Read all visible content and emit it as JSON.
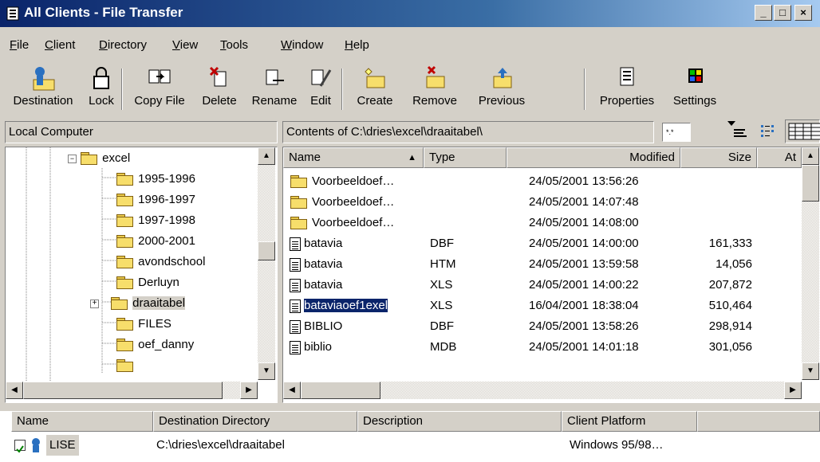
{
  "window": {
    "title": "All Clients - File Transfer",
    "buttons": [
      "_",
      "□",
      "×"
    ]
  },
  "menu": [
    {
      "label": "File",
      "u": "F",
      "rest": "ile"
    },
    {
      "label": "Client",
      "u": "C",
      "rest": "lient"
    },
    {
      "label": "Directory",
      "u": "D",
      "rest": "irectory"
    },
    {
      "label": "View",
      "u": "V",
      "rest": "iew"
    },
    {
      "label": "Tools",
      "u": "T",
      "rest": "ools"
    },
    {
      "label": "Window",
      "u": "W",
      "rest": "indow"
    },
    {
      "label": "Help",
      "u": "H",
      "rest": "elp"
    }
  ],
  "toolbar": {
    "destination": "Destination",
    "lock": "Lock",
    "copy_file": "Copy File",
    "delete": "Delete",
    "rename": "Rename",
    "edit": "Edit",
    "create": "Create",
    "remove": "Remove",
    "previous": "Previous",
    "properties": "Properties",
    "settings": "Settings"
  },
  "local_header": "Local Computer",
  "contents_header": "Contents of C:\\dries\\excel\\draaitabel\\",
  "filter_value": "*.*",
  "tree": [
    {
      "label": "excel",
      "expander": "−"
    },
    {
      "label": "1995-1996"
    },
    {
      "label": "1996-1997"
    },
    {
      "label": "1997-1998"
    },
    {
      "label": "2000-2001"
    },
    {
      "label": "avondschool"
    },
    {
      "label": "Derluyn"
    },
    {
      "label": "draaitabel",
      "expander": "+"
    },
    {
      "label": "FILES"
    },
    {
      "label": "oef_danny"
    }
  ],
  "columns": {
    "name": "Name",
    "type": "Type",
    "modified": "Modified",
    "size": "Size",
    "attr": "At"
  },
  "sort_indicator": "▲",
  "files": [
    {
      "name": "Voorbeeldoef…",
      "type": "",
      "modified": "24/05/2001 13:56:26",
      "size": "",
      "icon": "folder"
    },
    {
      "name": "Voorbeeldoef…",
      "type": "",
      "modified": "24/05/2001 14:07:48",
      "size": "",
      "icon": "folder"
    },
    {
      "name": "Voorbeeldoef…",
      "type": "",
      "modified": "24/05/2001 14:08:00",
      "size": "",
      "icon": "folder"
    },
    {
      "name": "batavia",
      "type": "DBF",
      "modified": "24/05/2001 14:00:00",
      "size": "161,333",
      "icon": "doc"
    },
    {
      "name": "batavia",
      "type": "HTM",
      "modified": "24/05/2001 13:59:58",
      "size": "14,056",
      "icon": "doc"
    },
    {
      "name": "batavia",
      "type": "XLS",
      "modified": "24/05/2001 14:00:22",
      "size": "207,872",
      "icon": "doc"
    },
    {
      "name": "bataviaoef1exel",
      "type": "XLS",
      "modified": "16/04/2001 18:38:04",
      "size": "510,464",
      "icon": "doc"
    },
    {
      "name": "BIBLIO",
      "type": "DBF",
      "modified": "24/05/2001 13:58:26",
      "size": "298,914",
      "icon": "doc"
    },
    {
      "name": "biblio",
      "type": "MDB",
      "modified": "24/05/2001 14:01:18",
      "size": "301,056",
      "icon": "doc"
    }
  ],
  "bottom_columns": {
    "name": "Name",
    "dest": "Destination Directory",
    "desc": "Description",
    "platform": "Client Platform"
  },
  "client": {
    "name": "LISE",
    "dest": "C:\\dries\\excel\\draaitabel",
    "desc": "",
    "platform": "Windows 95/98…",
    "checked": true
  }
}
